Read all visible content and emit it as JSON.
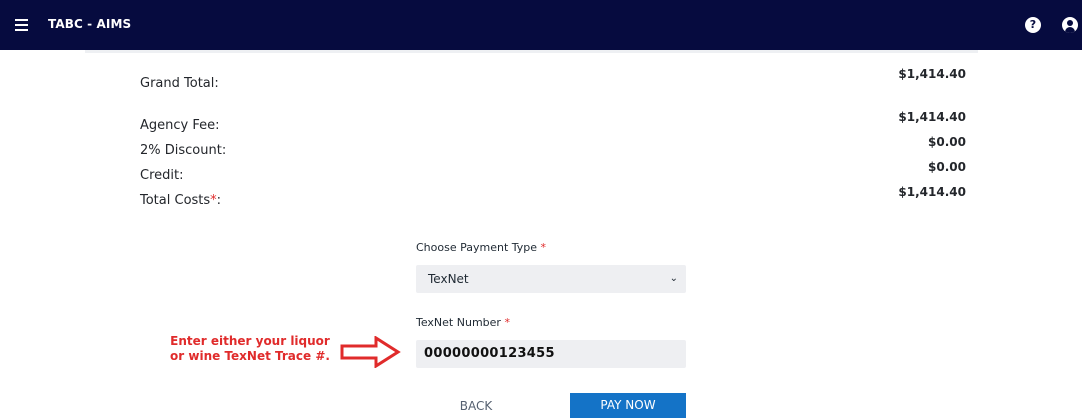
{
  "header": {
    "app_title": "TABC - AIMS",
    "help_glyph": "?",
    "icons": [
      "hamburger-menu-icon",
      "help-icon",
      "user-icon"
    ],
    "background": "#060b3f"
  },
  "summary": {
    "grand_total_label": "Grand Total:",
    "grand_total_value": "$1,414.40",
    "agency_fee_label": "Agency Fee:",
    "agency_fee_value": "$1,414.40",
    "discount_label": "2% Discount:",
    "discount_value": "$0.00",
    "credit_label": "Credit:",
    "credit_value": "$0.00",
    "total_costs_label": "Total Costs",
    "total_costs_suffix": ":",
    "total_costs_value": "$1,414.40",
    "required_marker": "*"
  },
  "payment": {
    "payment_type_label": "Choose Payment Type",
    "payment_type_value": "TexNet",
    "texnet_label": "TexNet Number",
    "texnet_value": "00000000123455",
    "required_marker": "*"
  },
  "annotation": {
    "line1": "Enter either your liquor",
    "line2": "or wine TexNet Trace #.",
    "color": "#e02b2b"
  },
  "actions": {
    "back_label": "BACK",
    "pay_label": "PAY NOW",
    "pay_color": "#1473c7"
  }
}
